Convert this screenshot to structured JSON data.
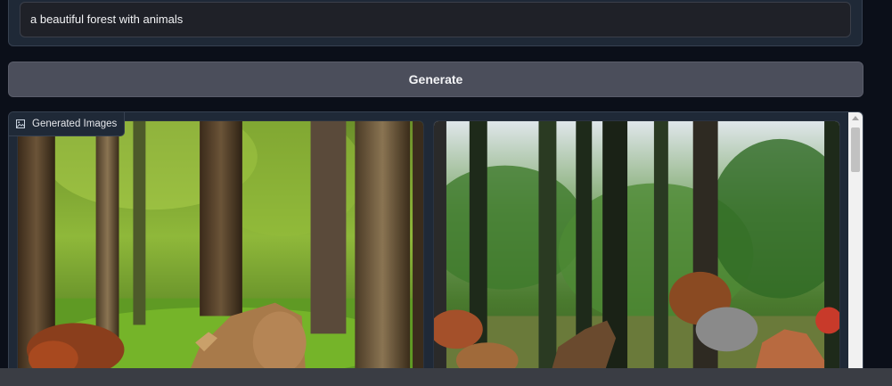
{
  "prompt": {
    "value": "a beautiful forest with animals"
  },
  "generate": {
    "label": "Generate"
  },
  "gallery": {
    "label": "Generated Images",
    "label_icon": "image-icon",
    "images": [
      {
        "description_icon": "forest-deer-image"
      },
      {
        "description_icon": "forest-animals-image"
      }
    ]
  },
  "colors": {
    "background": "#0b0f19",
    "panel": "#1f2937",
    "button": "#4b4e5b",
    "text": "#f3f4f6"
  }
}
